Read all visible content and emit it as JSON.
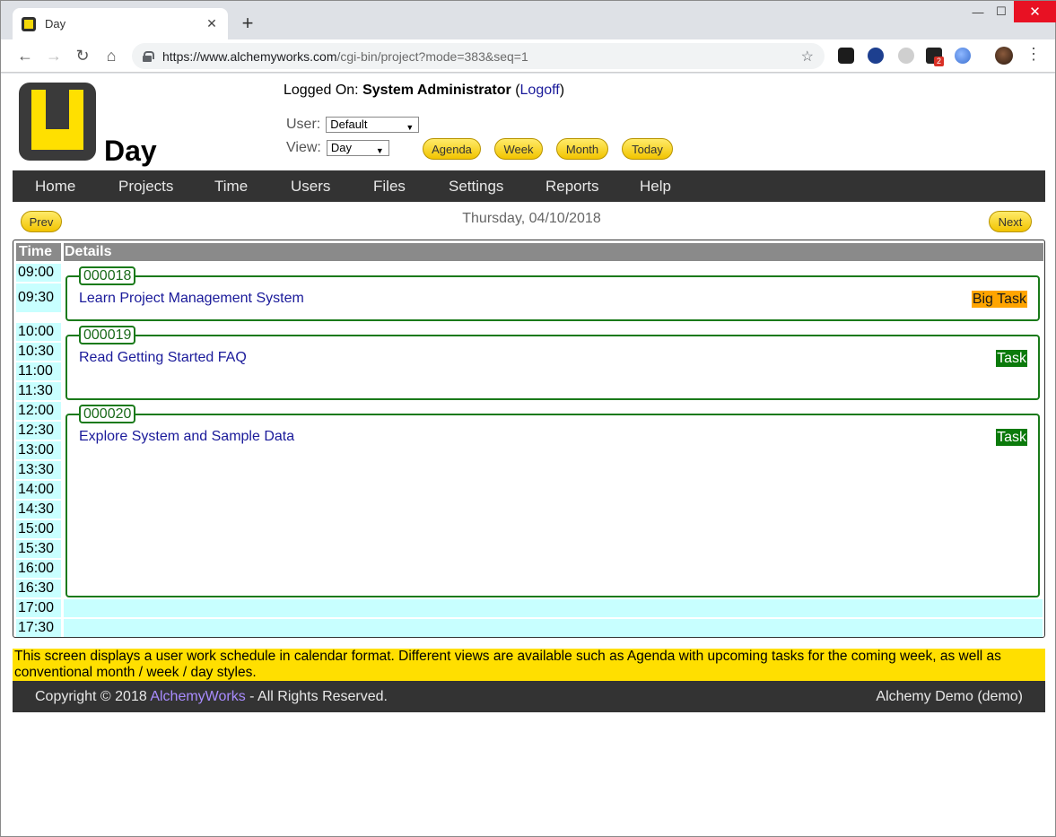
{
  "browser": {
    "tab_title": "Day",
    "url_host": "https://www.alchemyworks.com",
    "url_path": "/cgi-bin/project?mode=383&seq=1",
    "extension_badge": "2"
  },
  "header": {
    "page_title": "Day",
    "logged_on_label": "Logged On:",
    "user_name": "System Administrator",
    "logoff_label": "Logoff",
    "user_label": "User:",
    "user_value": "Default",
    "view_label": "View:",
    "view_value": "Day",
    "view_buttons": [
      "Agenda",
      "Week",
      "Month",
      "Today"
    ]
  },
  "menu": [
    "Home",
    "Projects",
    "Time",
    "Users",
    "Files",
    "Settings",
    "Reports",
    "Help"
  ],
  "date_nav": {
    "prev_label": "Prev",
    "next_label": "Next",
    "date": "Thursday, 04/10/2018"
  },
  "calendar": {
    "col_time": "Time",
    "col_details": "Details",
    "times": [
      "09:00",
      "09:30",
      "10:00",
      "10:30",
      "11:00",
      "11:30",
      "12:00",
      "12:30",
      "13:00",
      "13:30",
      "14:00",
      "14:30",
      "15:00",
      "15:30",
      "16:00",
      "16:30",
      "17:00",
      "17:30"
    ],
    "events": [
      {
        "id": "000018",
        "title": "Learn Project Management System",
        "type": "Big Task"
      },
      {
        "id": "000019",
        "title": "Read Getting Started FAQ",
        "type": "Task"
      },
      {
        "id": "000020",
        "title": "Explore System and Sample Data",
        "type": "Task"
      }
    ]
  },
  "info_text": "This screen displays a user work schedule in calendar format. Different views are available such as Agenda with upcoming tasks for the coming week, as well as conventional month / week / day styles.",
  "footer": {
    "copyright": "Copyright © 2018",
    "brand": "AlchemyWorks",
    "rights": "- All Rights Reserved.",
    "instance": "Alchemy Demo (demo)"
  },
  "colors": {
    "menu_bg": "#333333",
    "time_cell": "#c8ffff",
    "event_border": "#1a7a1a",
    "big_task": "#ffa500",
    "task": "#0b7a0b",
    "info_bar": "#ffdf00",
    "pill": "#f2c400"
  }
}
